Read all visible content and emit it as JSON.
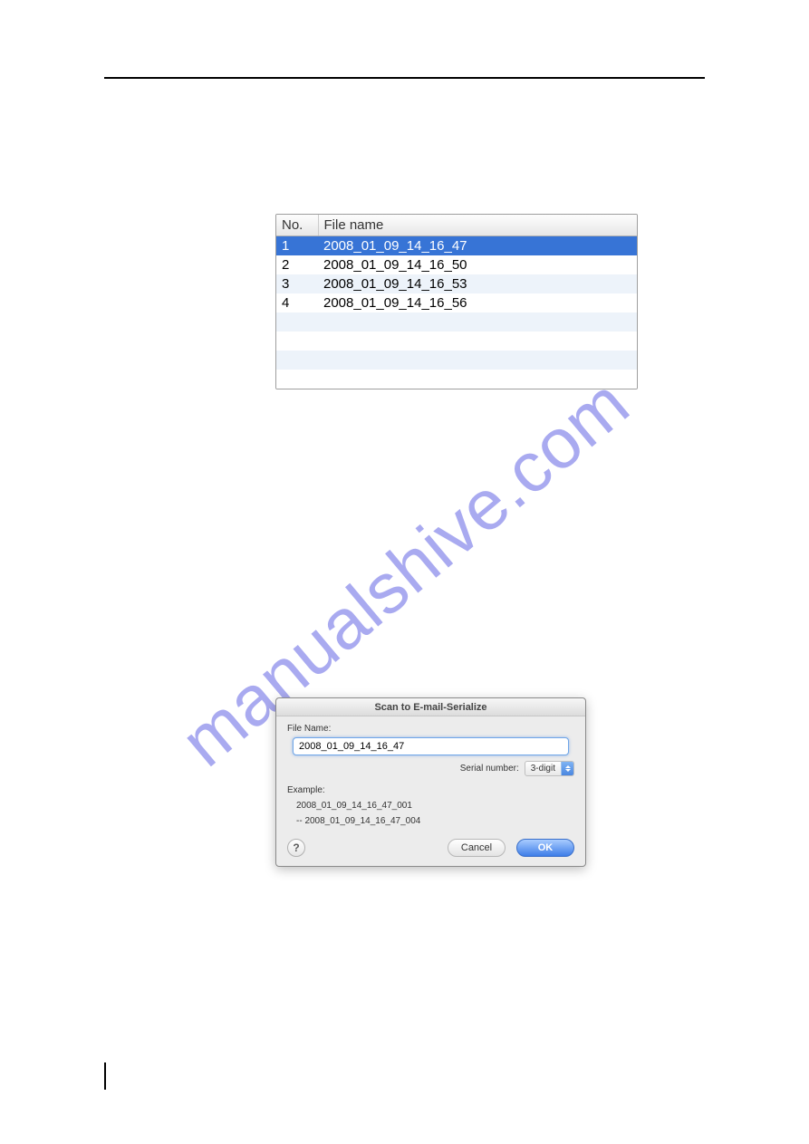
{
  "watermark": "manualshive.com",
  "table": {
    "headers": {
      "no": "No.",
      "filename": "File name"
    },
    "rows": [
      {
        "no": "1",
        "name": "2008_01_09_14_16_47",
        "selected": true
      },
      {
        "no": "2",
        "name": "2008_01_09_14_16_50",
        "selected": false
      },
      {
        "no": "3",
        "name": "2008_01_09_14_16_53",
        "selected": false
      },
      {
        "no": "4",
        "name": "2008_01_09_14_16_56",
        "selected": false
      }
    ]
  },
  "dialog": {
    "title": "Scan to E-mail-Serialize",
    "file_name_label": "File Name:",
    "file_name_value": "2008_01_09_14_16_47",
    "serial_label": "Serial number:",
    "serial_value": "3-digit",
    "example_label": "Example:",
    "example_line1": "2008_01_09_14_16_47_001",
    "example_line2": "--    2008_01_09_14_16_47_004",
    "help": "?",
    "cancel": "Cancel",
    "ok": "OK"
  }
}
